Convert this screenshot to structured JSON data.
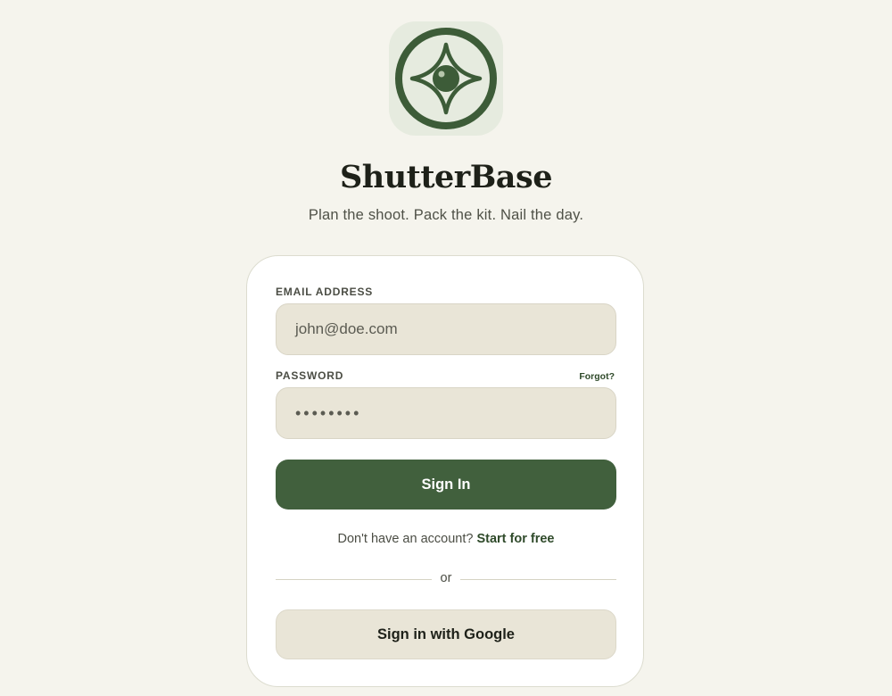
{
  "brand": {
    "name": "ShutterBase",
    "tagline": "Plan the shoot. Pack the kit. Nail the day.",
    "logo_icon": "aperture-lens-icon",
    "accent_color": "#41603d"
  },
  "login": {
    "email_label": "EMAIL ADDRESS",
    "email_value": "john@doe.com",
    "password_label": "PASSWORD",
    "password_value": "••••••••",
    "forgot_label": "Forgot?",
    "signin_label": "Sign In",
    "signup_prompt": "Don't have an account?",
    "signup_link": "Start for free",
    "divider_text": "or",
    "google_label": "Sign in with Google"
  }
}
